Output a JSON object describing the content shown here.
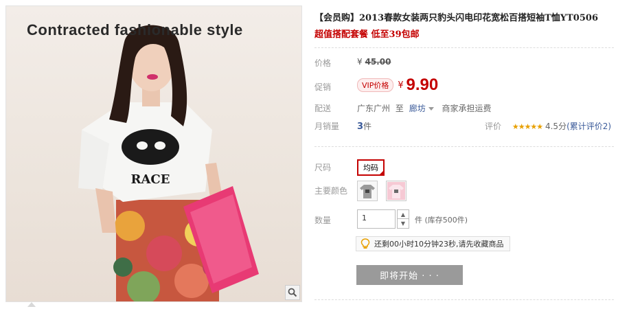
{
  "image": {
    "caption": "Contracted fashionable style"
  },
  "product": {
    "title": "【会员购】2013春款女装两只豹头闪电印花宽松百搭短袖T恤YT0506",
    "subtitle": "超值搭配套餐 低至39包邮"
  },
  "price": {
    "label": "价格",
    "currency": "¥",
    "original": "45.00"
  },
  "promo": {
    "label": "促销",
    "badge": "VIP价格",
    "currency": "¥",
    "price": "9.90"
  },
  "shipping": {
    "label": "配送",
    "from": "广东广州",
    "to_word": "至",
    "to": "廊坊",
    "note": "商家承担运费"
  },
  "sales": {
    "label": "月销量",
    "count": "3",
    "unit": "件",
    "rating_label": "评价",
    "stars": "★★★★★",
    "score": "4.5分",
    "reviews": "(累计评价2)"
  },
  "size": {
    "label": "尺码",
    "options": [
      "均码"
    ]
  },
  "color": {
    "label": "主要颜色",
    "options": [
      "gray-tshirt",
      "pink-tshirt"
    ]
  },
  "quantity": {
    "label": "数量",
    "value": "1",
    "unit": "件",
    "stock": "(库存500件)"
  },
  "timer": {
    "text": "还剩00小时10分钟23秒,请先收藏商品"
  },
  "action": {
    "start_label": "即将开始 · · ·"
  },
  "colors": {
    "accent": "#c40000",
    "button_gray": "#9a9a9a",
    "link_blue": "#3a5a99"
  }
}
